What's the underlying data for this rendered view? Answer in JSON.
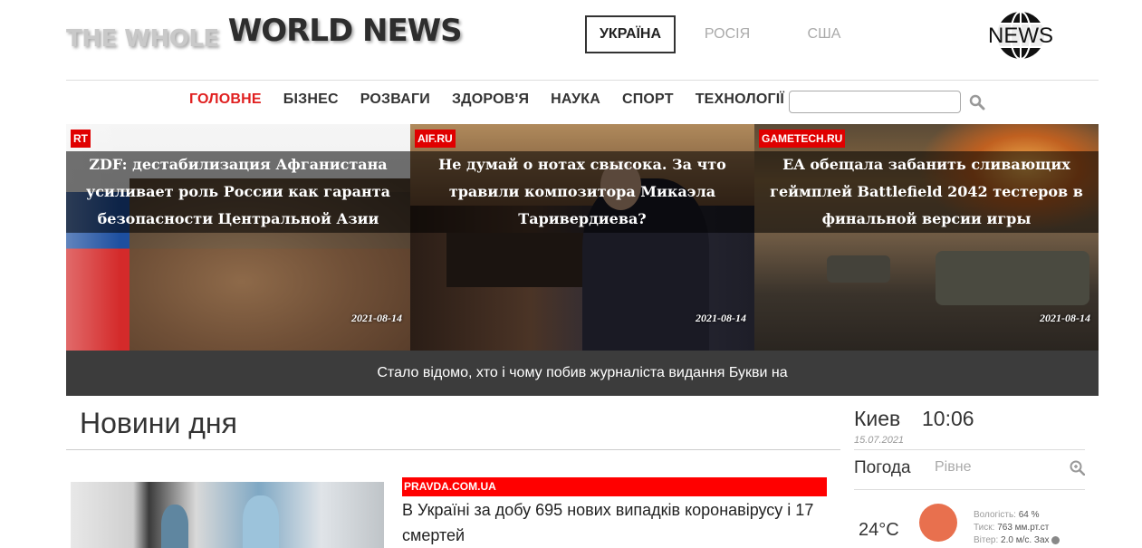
{
  "header": {
    "logo_part1": "THE WHOLE",
    "logo_part2": "WORLD NEWS",
    "countries": [
      {
        "label": "УКРАЇНА",
        "active": true
      },
      {
        "label": "РОСІЯ",
        "active": false
      },
      {
        "label": "США",
        "active": false
      }
    ],
    "news_logo_text": "NEWS"
  },
  "nav": {
    "items": [
      "ГОЛОВНЕ",
      "БІЗНЕС",
      "РОЗВАГИ",
      "ЗДОРОВ'Я",
      "НАУКА",
      "СПОРТ",
      "ТЕХНОЛОГІЇ"
    ],
    "active_index": 0,
    "search_placeholder": "",
    "search_icon": "magnifier-icon"
  },
  "slider": {
    "slides": [
      {
        "source": "RT",
        "title": "ZDF: дестабилизация Афганистана усиливает роль России как гаранта безопасности Центральной Азии",
        "date": "2021-08-14"
      },
      {
        "source": "AIF.RU",
        "title": "Не думай о нотах свысока. За что травили композитора Микаэла Таривердиева?",
        "date": "2021-08-14"
      },
      {
        "source": "GAMETECH.RU",
        "title": "EA обещала забанить сливающих геймплей Battlefield 2042 тестеров в финальной версии игры",
        "date": "2021-08-14"
      }
    ],
    "ticker": "Стало відомо, хто і чому побив журналіста видання Букви на"
  },
  "main": {
    "section_title": "Новини дня",
    "story": {
      "source": "PRAVDA.COM.UA",
      "title": "В Україні за добу 695 нових випадків коронавірусу і 17 смертей"
    }
  },
  "widget": {
    "city": "Киев",
    "time": "10:06",
    "date": "15.07.2021",
    "weather_label": "Погода",
    "weather_city": "Рівне",
    "temperature": "24°C",
    "humidity_label": "Вологість:",
    "humidity_value": "64 %",
    "pressure_label": "Тиск:",
    "pressure_value": "763 мм.рт.ст",
    "wind_label": "Вітер:",
    "wind_value": "2.0 м/с. Зах"
  },
  "colors": {
    "accent_red": "#e00000",
    "active_nav": "#e02020",
    "sun": "#e8704e"
  }
}
